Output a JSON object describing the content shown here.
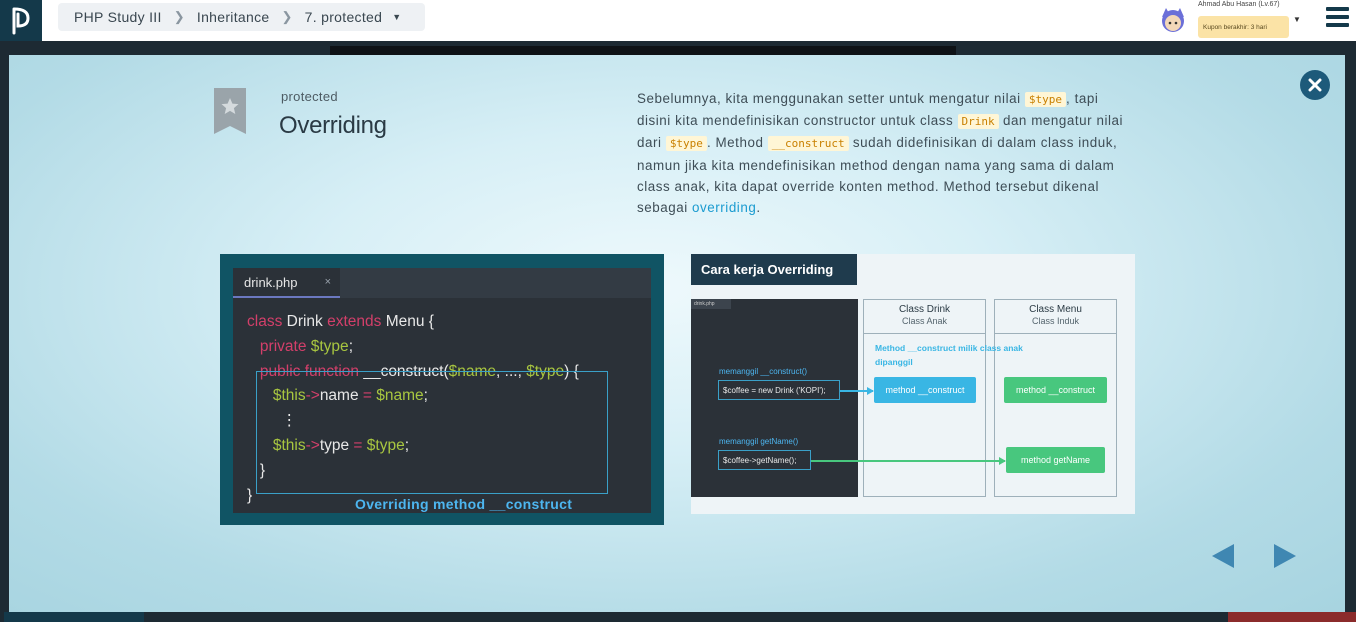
{
  "header": {
    "breadcrumb": [
      "PHP Study III",
      "Inheritance",
      "7. protected"
    ],
    "user_name": "Ahmad Abu Hasan (Lv.67)",
    "coupon_text": "Kupon berakhir: 3 hari"
  },
  "slide": {
    "subtitle": "protected",
    "title": "Overriding",
    "desc": {
      "t1": "Sebelumnya, kita menggunakan setter untuk mengatur nilai ",
      "c1": "$type",
      "t2": ", tapi disini kita mendefinisikan constructor untuk class ",
      "c2": "Drink",
      "t3": " dan mengatur nilai dari ",
      "c3": "$type",
      "t4": ". Method ",
      "c4": "__construct",
      "t5": " sudah didefinisikan di dalam class induk, namun jika kita mendefinisikan method dengan nama yang sama di dalam class anak, kita dapat override konten method. Method tersebut dikenal sebagai ",
      "link": "overriding",
      "t6": "."
    }
  },
  "code_image": {
    "filename": "drink.php",
    "tab_close": "×",
    "lines": {
      "l1_kw1": "class",
      "l1_name": " Drink ",
      "l1_kw2": "extends",
      "l1_rest": " Menu {",
      "l2_kw": "private",
      "l2_var": " $type",
      "l2_rest": ";",
      "l3_kw": "public function",
      "l3_fn": " __construct(",
      "l3_v1": "$name",
      "l3_mid": ", ..., ",
      "l3_v2": "$type",
      "l3_rest": ") {",
      "l4_v1": "$this",
      "l4_op": "->",
      "l4_prop": "name ",
      "l4_eq": "=",
      "l4_v2": " $name",
      "l4_rest": ";",
      "l5": "⋮",
      "l6_v1": "$this",
      "l6_op": "->",
      "l6_prop": "type ",
      "l6_eq": "=",
      "l6_v2": " $type",
      "l6_rest": ";",
      "l7": "}",
      "l8": "}"
    },
    "caption": "Overriding method __construct"
  },
  "diagram_image": {
    "title": "Cara kerja Overriding",
    "file_tab": "drink.php",
    "call1_label": "memanggil __construct()",
    "call1_code": "$coffee = new Drink ('KOPI');",
    "call2_label": "memanggil getName()",
    "call2_code": "$coffee->getName();",
    "col1_title": "Class Drink",
    "col1_sub": "Class Anak",
    "col2_title": "Class Menu",
    "col2_sub": "Class Induk",
    "note": "Method __construct milik class anak dipanggil",
    "m1": "method __construct",
    "m2": "method __construct",
    "m3": "method getName"
  },
  "colors": {
    "accent": "#1a9bd0",
    "close_button": "#1d5a7a",
    "nav_arrow": "#3f87b2",
    "logo_bg": "#14394a"
  },
  "icons": {
    "logo": "progate-logo-icon",
    "bookmark": "star-bookmark-icon",
    "close": "close-icon",
    "prev": "prev-arrow-icon",
    "next": "next-arrow-icon",
    "menu": "hamburger-menu-icon"
  }
}
